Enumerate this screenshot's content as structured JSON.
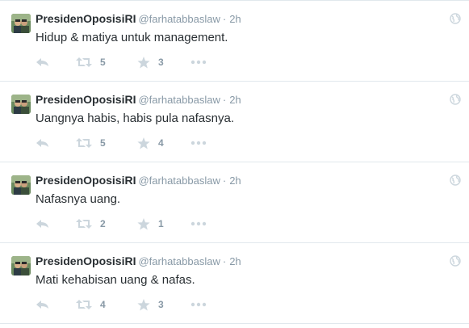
{
  "colors": {
    "icon": "#ccd6dd",
    "meta": "#8899a6",
    "text": "#292f33",
    "divider": "#e1e8ed"
  },
  "tweets": [
    {
      "fullname": "PresidenOposisiRI",
      "username": "@farhatabbaslaw",
      "separator": "·",
      "time": "2h",
      "text": "Hidup & matiya untuk management.",
      "retweets": "5",
      "favorites": "3"
    },
    {
      "fullname": "PresidenOposisiRI",
      "username": "@farhatabbaslaw",
      "separator": "·",
      "time": "2h",
      "text": "Uangnya habis, habis pula nafasnya.",
      "retweets": "5",
      "favorites": "4"
    },
    {
      "fullname": "PresidenOposisiRI",
      "username": "@farhatabbaslaw",
      "separator": "·",
      "time": "2h",
      "text": "Nafasnya uang.",
      "retweets": "2",
      "favorites": "1"
    },
    {
      "fullname": "PresidenOposisiRI",
      "username": "@farhatabbaslaw",
      "separator": "·",
      "time": "2h",
      "text": "Mati kehabisan uang & nafas.",
      "retweets": "4",
      "favorites": "3"
    }
  ]
}
